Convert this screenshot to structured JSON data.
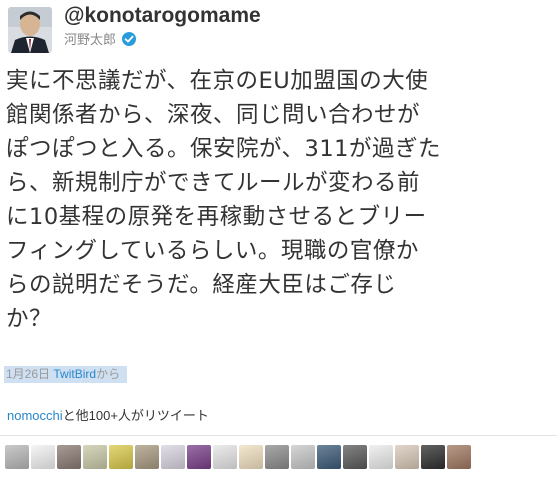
{
  "tweet": {
    "handle": "@konotarogomame",
    "name": "河野太郎",
    "text": "実に不思議だが、在京のEU加盟国の大使\n館関係者から、深夜、同じ問い合わせが\nぽつぽつと入る。保安院が、311が過ぎた\nら、新規制庁ができてルールが変わる前\nに10基程の原発を再稼動させるとブリー\nフィングしているらしい。現職の官僚か\nらの説明だそうだ。経産大臣はご存じ\nか？",
    "date": "1月26日",
    "via_client": "TwitBird",
    "via_suffix": "から"
  },
  "retweets": {
    "user": "nomocchi",
    "suffix": "と他100+人がリツイート",
    "avatars": [
      {
        "icon": "avatar-1",
        "color": "#b8b8b8"
      },
      {
        "icon": "avatar-2",
        "color": "#f2f2f2"
      },
      {
        "icon": "avatar-3",
        "color": "#8a7a72"
      },
      {
        "icon": "avatar-4",
        "color": "#c9c9a8"
      },
      {
        "icon": "avatar-5",
        "color": "#d9c94a"
      },
      {
        "icon": "avatar-6",
        "color": "#a89a80"
      },
      {
        "icon": "avatar-7",
        "color": "#d8d4e0"
      },
      {
        "icon": "avatar-8",
        "color": "#7a3f8a"
      },
      {
        "icon": "avatar-9",
        "color": "#e6e6e6"
      },
      {
        "icon": "avatar-10",
        "color": "#f0e0c0"
      },
      {
        "icon": "avatar-11",
        "color": "#8c8c8c"
      },
      {
        "icon": "avatar-12",
        "color": "#c8c8c8"
      },
      {
        "icon": "avatar-13",
        "color": "#3c5a78"
      },
      {
        "icon": "avatar-14",
        "color": "#5a5a5a"
      },
      {
        "icon": "avatar-15",
        "color": "#ececec"
      },
      {
        "icon": "avatar-16",
        "color": "#d8c8b8"
      },
      {
        "icon": "avatar-17",
        "color": "#2e2e2e"
      },
      {
        "icon": "avatar-18",
        "color": "#a07860"
      }
    ]
  },
  "colors": {
    "link": "#2a86cc",
    "verified": "#2a9cdb",
    "highlight": "#cfe0f2"
  }
}
